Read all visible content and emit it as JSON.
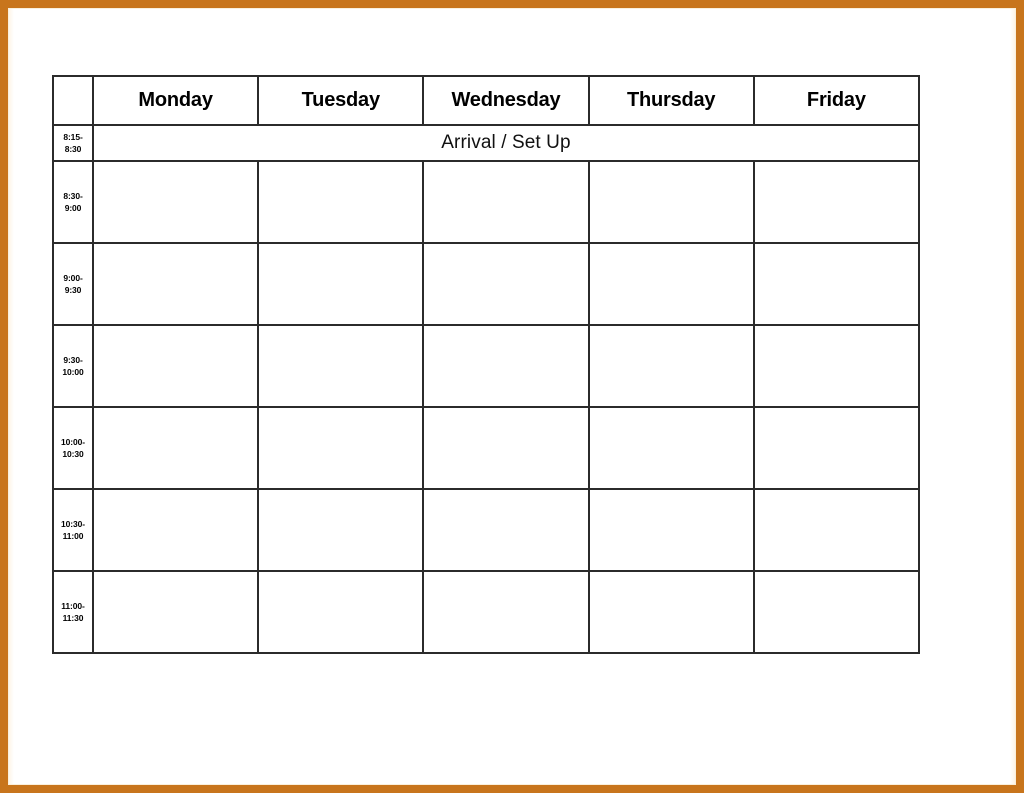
{
  "page": {
    "background_color": "#ffffff",
    "frame_color": "#C8751C",
    "frame_thickness_px": 8
  },
  "schedule": {
    "corner_label": "",
    "day_headers": [
      {
        "label": "Monday"
      },
      {
        "label": "Tuesday"
      },
      {
        "label": "Wednesday"
      },
      {
        "label": "Thursday"
      },
      {
        "label": "Friday"
      }
    ],
    "arrival_row": {
      "time_start": "8:15-",
      "time_end": "8:30",
      "label": "Arrival / Set Up",
      "spans_all_days": true
    },
    "rows": [
      {
        "time_start": "8:30-",
        "time_end": "9:00",
        "cells": [
          "",
          "",
          "",
          "",
          ""
        ]
      },
      {
        "time_start": "9:00-",
        "time_end": "9:30",
        "cells": [
          "",
          "",
          "",
          "",
          ""
        ]
      },
      {
        "time_start": "9:30-",
        "time_end": "10:00",
        "cells": [
          "",
          "",
          "",
          "",
          ""
        ]
      },
      {
        "time_start": "10:00-",
        "time_end": "10:30",
        "cells": [
          "",
          "",
          "",
          "",
          ""
        ]
      },
      {
        "time_start": "10:30-",
        "time_end": "11:00",
        "cells": [
          "",
          "",
          "",
          "",
          ""
        ]
      },
      {
        "time_start": "11:00-",
        "time_end": "11:30",
        "cells": [
          "",
          "",
          "",
          "",
          ""
        ]
      }
    ]
  }
}
